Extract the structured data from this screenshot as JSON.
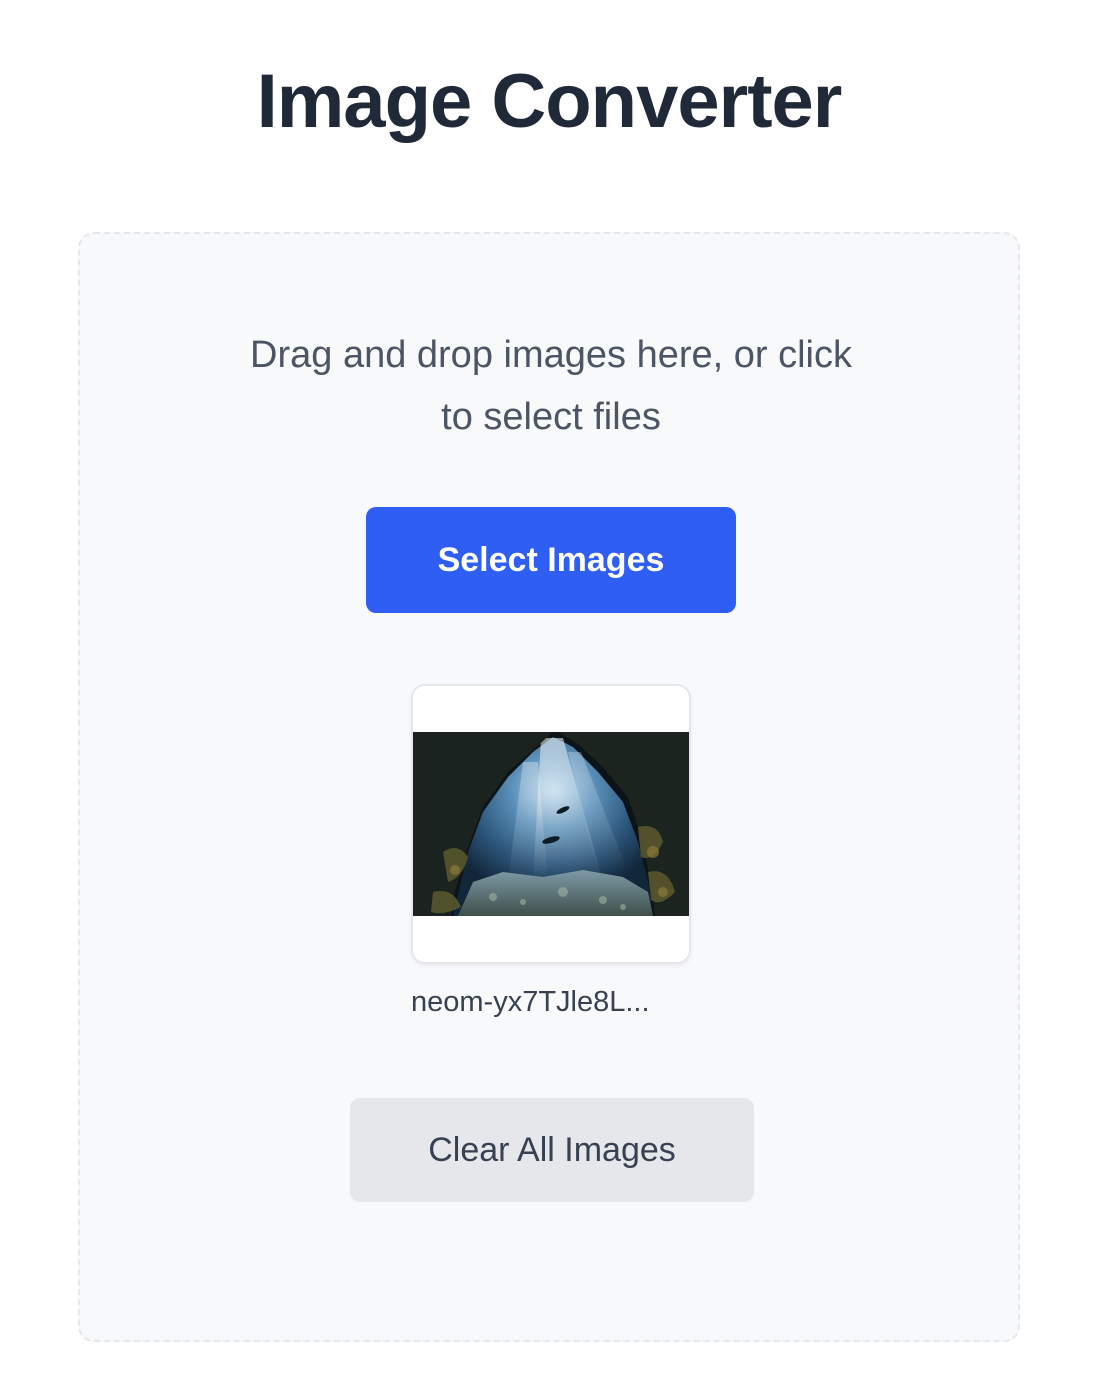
{
  "header": {
    "title": "Image Converter"
  },
  "dropzone": {
    "instructions": "Drag and drop images here, or click to select files",
    "select_button_label": "Select Images",
    "clear_button_label": "Clear All Images"
  },
  "images": [
    {
      "filename": "neom-yx7TJle8L..."
    }
  ],
  "colors": {
    "primary": "#2f5ef5",
    "dropzone_bg": "#f8f9fb",
    "secondary_button_bg": "#e5e7eb",
    "heading_text": "#1f2937",
    "body_text": "#4b5563"
  }
}
